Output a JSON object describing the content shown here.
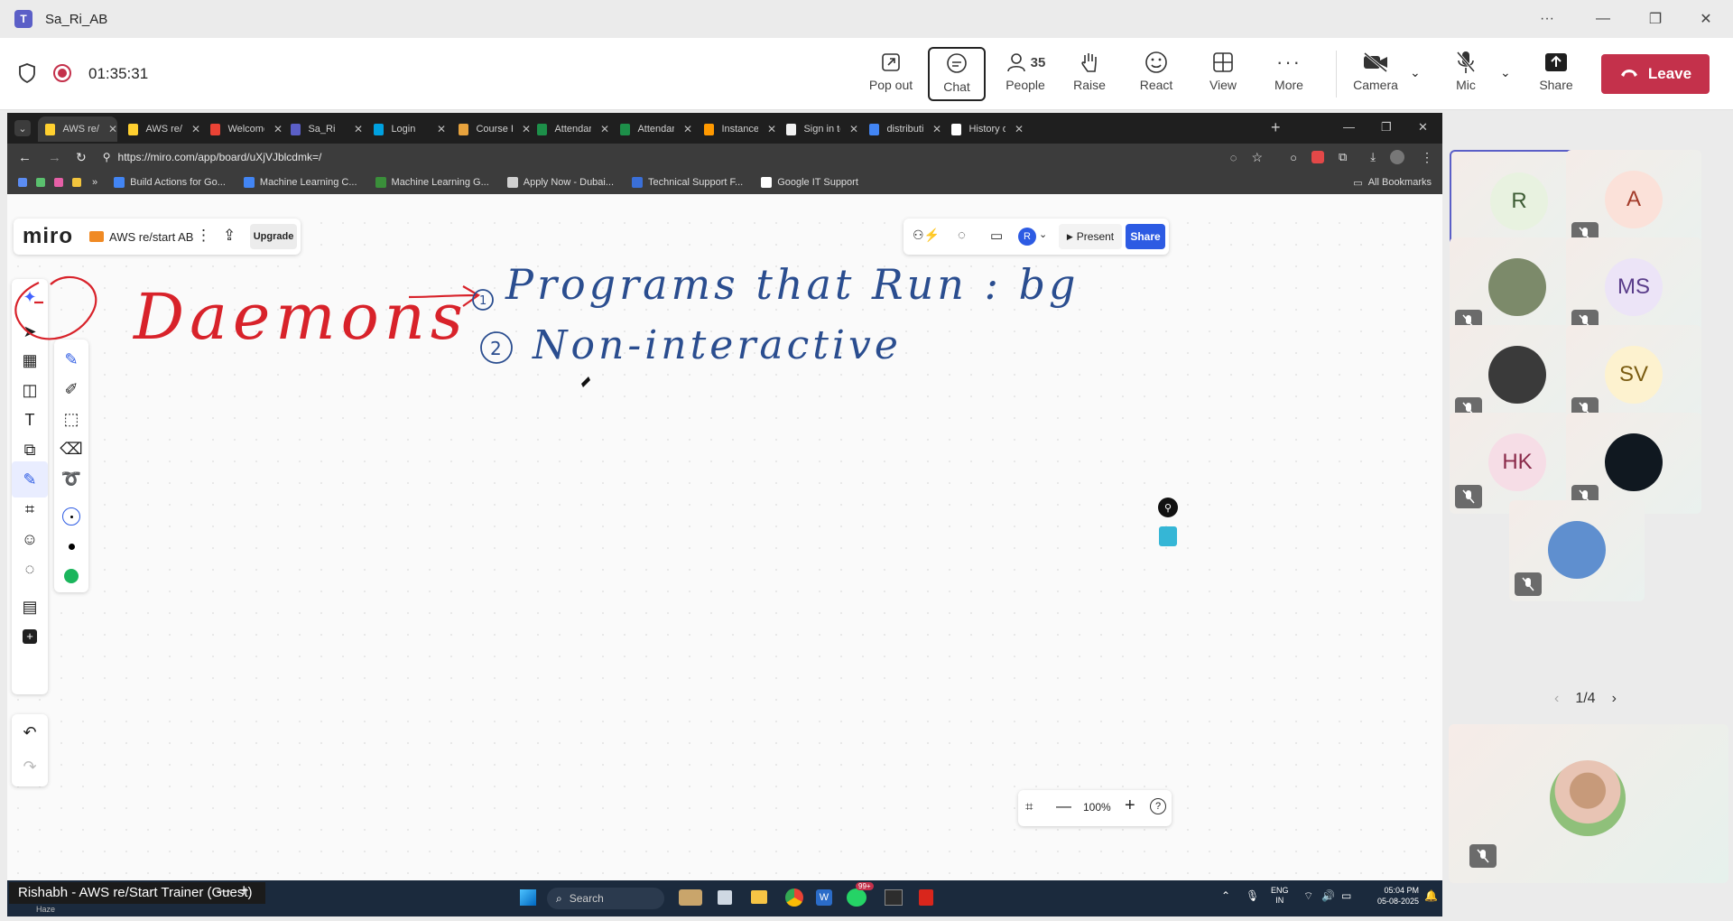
{
  "titlebar": {
    "title": "Sa_Ri_AB"
  },
  "meeting": {
    "timer": "01:35:31",
    "tools": {
      "popout": "Pop out",
      "chat": "Chat",
      "people": "People",
      "people_count": "35",
      "raise": "Raise",
      "react": "React",
      "view": "View",
      "more": "More",
      "camera": "Camera",
      "mic": "Mic",
      "share": "Share"
    },
    "leave": "Leave"
  },
  "browser": {
    "tabs": [
      {
        "label": "AWS re/s",
        "color": "#ffd02f"
      },
      {
        "label": "AWS re/s",
        "color": "#ffd02f"
      },
      {
        "label": "Welcome",
        "color": "#ea4335"
      },
      {
        "label": "Sa_Ri",
        "color": "#5b5fc7"
      },
      {
        "label": "Login",
        "color": "#00a1e0"
      },
      {
        "label": "Course R",
        "color": "#e8a33d"
      },
      {
        "label": "Attendan",
        "color": "#1d8f49"
      },
      {
        "label": "Attendan",
        "color": "#1d8f49"
      },
      {
        "label": "Instances",
        "color": "#ff9900"
      },
      {
        "label": "Sign in to",
        "color": "#f2f2f2"
      },
      {
        "label": "distributi",
        "color": "#4285f4"
      },
      {
        "label": "History o",
        "color": "#ffffff"
      }
    ],
    "url": "https://miro.com/app/board/uXjVJblcdmk=/",
    "bookmarks": [
      {
        "label": "Build Actions for Go...",
        "color": "#4285f4"
      },
      {
        "label": "Machine Learning C...",
        "color": "#4285f4"
      },
      {
        "label": "Machine Learning G...",
        "color": "#3a8f3a"
      },
      {
        "label": "Apply Now - Dubai...",
        "color": "#d0d0d0"
      },
      {
        "label": "Technical Support F...",
        "color": "#3a6fd8"
      },
      {
        "label": "Google IT Support",
        "color": "#ffffff"
      }
    ],
    "all_bookmarks": "All Bookmarks"
  },
  "miro": {
    "logo": "miro",
    "board_name": "AWS re/start AB",
    "upgrade": "Upgrade",
    "present": "Present",
    "share": "Share",
    "user_initial": "R",
    "zoom": "100%",
    "handwriting": {
      "heading": "Daemons",
      "point1": "Programs that Run : bg",
      "point2": "Non-interactive",
      "heading_color": "#d8222a",
      "ink_color": "#2a4d8f"
    }
  },
  "taskbar": {
    "presenter": "Rishabh - AWS re/Start Trainer (Guest)",
    "weather": "Haze",
    "search": "Search",
    "lang": "ENG",
    "region": "IN",
    "time": "05:04 PM",
    "date": "05-08-2025",
    "badge": "99+"
  },
  "participants": {
    "tiles": [
      {
        "initials": "R",
        "bg": "#e8f2e0",
        "color": "#3d5c34"
      },
      {
        "initials": "A",
        "bg": "#fbe1d9",
        "color": "#a33b2a"
      },
      {
        "initials": "",
        "bg": "#7c8a6a",
        "color": "#fff"
      },
      {
        "initials": "MS",
        "bg": "#ece4f7",
        "color": "#5a3d8a"
      },
      {
        "initials": "",
        "bg": "#3a3a3a",
        "color": "#fff"
      },
      {
        "initials": "SV",
        "bg": "#fdf2cf",
        "color": "#7a5c12"
      },
      {
        "initials": "HK",
        "bg": "#f6dde6",
        "color": "#8a2a4a"
      },
      {
        "initials": "",
        "bg": "#101820",
        "color": "#fff"
      },
      {
        "initials": "",
        "bg": "#5f8fcf",
        "color": "#fff"
      }
    ],
    "pager": "1/4"
  }
}
